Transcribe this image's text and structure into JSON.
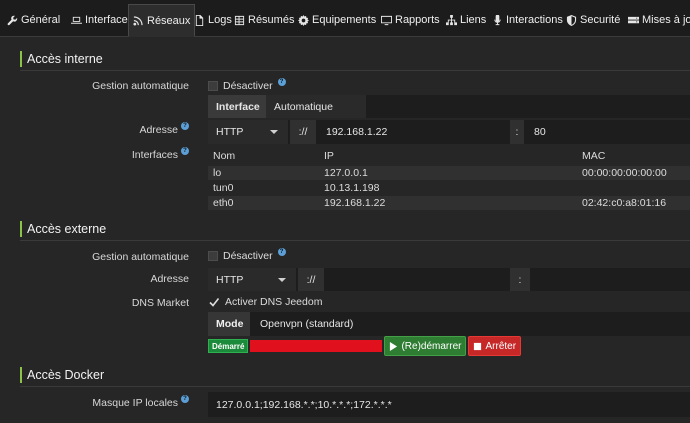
{
  "tabs": [
    {
      "label": "Général",
      "icon": "wrench-icon"
    },
    {
      "label": "Interface",
      "icon": "laptop-icon"
    },
    {
      "label": "Réseaux",
      "icon": "rss-icon"
    },
    {
      "label": "Logs",
      "icon": "file-icon"
    },
    {
      "label": "Résumés",
      "icon": "table-icon"
    },
    {
      "label": "Equipements",
      "icon": "gear-icon"
    },
    {
      "label": "Rapports",
      "icon": "monitor-icon"
    },
    {
      "label": "Liens",
      "icon": "sitemap-icon"
    },
    {
      "label": "Interactions",
      "icon": "microphone-icon"
    },
    {
      "label": "Securité",
      "icon": "shield-icon"
    },
    {
      "label": "Mises à jour",
      "icon": "server-icon"
    }
  ],
  "internal": {
    "title": "Accès interne",
    "auto_label": "Gestion automatique",
    "disable_label": "Désactiver",
    "mode_tabs": [
      "Interface",
      "Automatique"
    ],
    "address_label": "Adresse",
    "protocol": "HTTP",
    "separator": "://",
    "host": "192.168.1.22",
    "port_sep": ":",
    "port": "80",
    "interfaces_label": "Interfaces",
    "headers": [
      "Nom",
      "IP",
      "MAC"
    ],
    "rows": [
      {
        "name": "lo",
        "ip": "127.0.0.1",
        "mac": "00:00:00:00:00:00"
      },
      {
        "name": "tun0",
        "ip": "10.13.1.198",
        "mac": ""
      },
      {
        "name": "eth0",
        "ip": "192.168.1.22",
        "mac": "02:42:c0:a8:01:16"
      }
    ]
  },
  "external": {
    "title": "Accès externe",
    "auto_label": "Gestion automatique",
    "disable_label": "Désactiver",
    "address_label": "Adresse",
    "protocol": "HTTP",
    "separator": "://",
    "host": "",
    "port_sep": ":",
    "dns_label": "DNS Market",
    "dns_check": "Activer DNS Jeedom",
    "mode_label": "Mode",
    "mode_value": "Openvpn (standard)",
    "status_badge": "Démarré",
    "restart_label": "(Re)démarrer",
    "stop_label": "Arrêter"
  },
  "docker": {
    "title": "Accès Docker",
    "mask_label": "Masque IP locales",
    "mask_value": "127.0.0.1;192.168.*.*;10.*.*.*;172.*.*.*"
  },
  "colors": {
    "accent": "#8bc34a",
    "success": "#1b8a3a",
    "danger": "#c62828"
  }
}
